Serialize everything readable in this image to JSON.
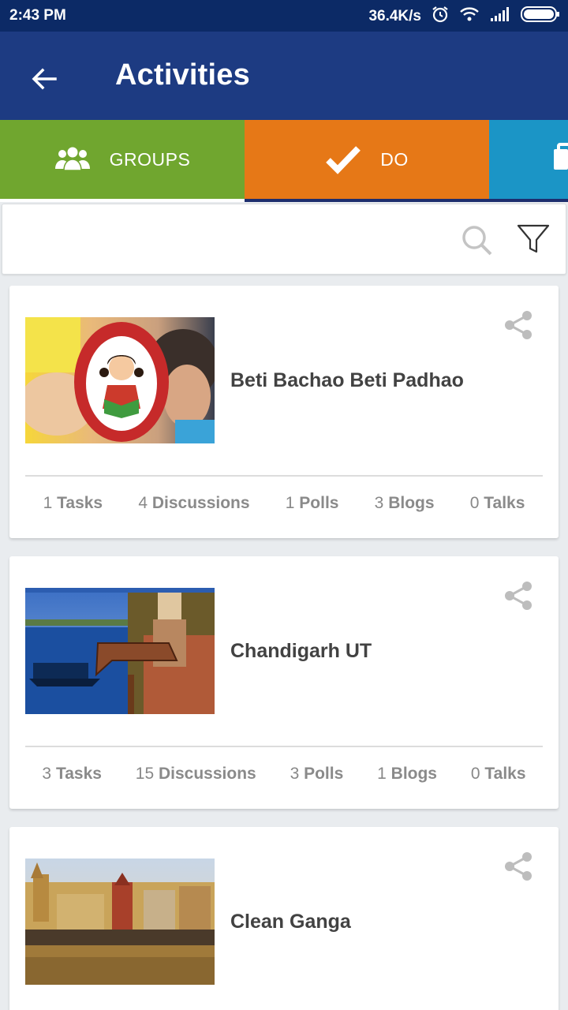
{
  "status_bar": {
    "time": "2:43 PM",
    "network_speed": "36.4K/s"
  },
  "app_bar": {
    "title": "Activities"
  },
  "tabs": [
    {
      "label": "GROUPS",
      "color": "#70a62f"
    },
    {
      "label": "DO",
      "color": "#e67817"
    },
    {
      "label": "",
      "color": "#1b95c6"
    }
  ],
  "search": {
    "placeholder": ""
  },
  "activities": [
    {
      "title": "Beti Bachao Beti Padhao",
      "stats": [
        {
          "count": "1",
          "label": "Tasks"
        },
        {
          "count": "4",
          "label": "Discussions"
        },
        {
          "count": "1",
          "label": "Polls"
        },
        {
          "count": "3",
          "label": "Blogs"
        },
        {
          "count": "0",
          "label": "Talks"
        }
      ]
    },
    {
      "title": "Chandigarh UT",
      "stats": [
        {
          "count": "3",
          "label": "Tasks"
        },
        {
          "count": "15",
          "label": "Discussions"
        },
        {
          "count": "3",
          "label": "Polls"
        },
        {
          "count": "1",
          "label": "Blogs"
        },
        {
          "count": "0",
          "label": "Talks"
        }
      ]
    },
    {
      "title": "Clean Ganga",
      "stats": []
    }
  ]
}
